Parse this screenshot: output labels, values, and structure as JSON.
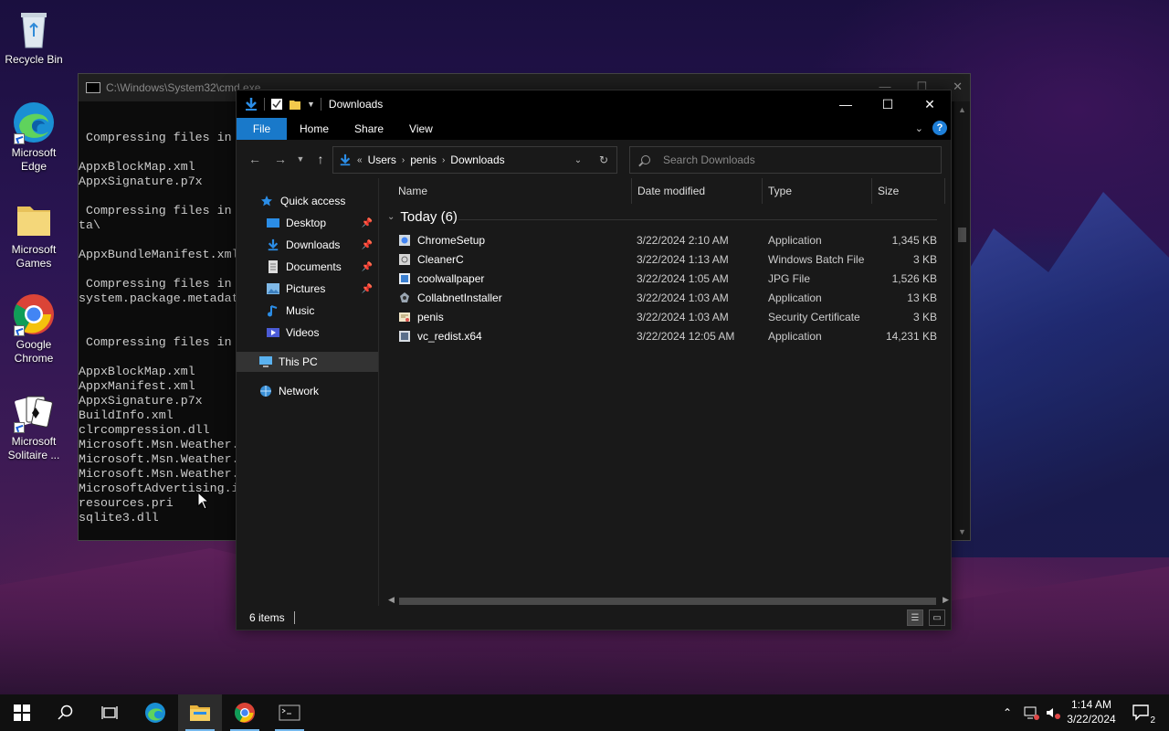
{
  "desktop": {
    "icons": [
      {
        "label": "Recycle Bin"
      },
      {
        "label": "Microsoft Edge"
      },
      {
        "label": "Microsoft Games"
      },
      {
        "label": "Google Chrome"
      },
      {
        "label": "Microsoft Solitaire ..."
      }
    ]
  },
  "cmd": {
    "title": "C:\\Windows\\System32\\cmd.exe",
    "lines": [
      " Compressing files in",
      "AppxBlockMap.xml",
      "AppxSignature.p7x",
      " Compressing files in",
      "ta\\",
      "AppxBundleManifest.xml",
      " Compressing files in",
      "system.package.metadat",
      " Compressing files in",
      "AppxBlockMap.xml",
      "AppxManifest.xml",
      "AppxSignature.p7x",
      "BuildInfo.xml",
      "clrcompression.dll",
      "Microsoft.Msn.Weather.",
      "Microsoft.Msn.Weather.",
      "Microsoft.Msn.Weather.",
      "MicrosoftAdvertising.i",
      "resources.pri",
      "sqlite3.dll"
    ]
  },
  "explorer": {
    "title": "Downloads",
    "ribbon": {
      "tabs": [
        "File",
        "Home",
        "Share",
        "View"
      ],
      "help": "?"
    },
    "address": {
      "overflow": "«",
      "crumbs": [
        "Users",
        "penis",
        "Downloads"
      ]
    },
    "search": {
      "placeholder": "Search Downloads"
    },
    "nav": {
      "quick_access": "Quick access",
      "items": [
        "Desktop",
        "Downloads",
        "Documents",
        "Pictures",
        "Music",
        "Videos"
      ],
      "this_pc": "This PC",
      "network": "Network"
    },
    "columns": [
      "Name",
      "Date modified",
      "Type",
      "Size"
    ],
    "group": "Today (6)",
    "files": [
      {
        "name": "ChromeSetup",
        "date": "3/22/2024 2:10 AM",
        "type": "Application",
        "size": "1,345 KB"
      },
      {
        "name": "CleanerC",
        "date": "3/22/2024 1:13 AM",
        "type": "Windows Batch File",
        "size": "3 KB"
      },
      {
        "name": "coolwallpaper",
        "date": "3/22/2024 1:05 AM",
        "type": "JPG File",
        "size": "1,526 KB"
      },
      {
        "name": "CollabnetInstaller",
        "date": "3/22/2024 1:03 AM",
        "type": "Application",
        "size": "13 KB"
      },
      {
        "name": "penis",
        "date": "3/22/2024 1:03 AM",
        "type": "Security Certificate",
        "size": "3 KB"
      },
      {
        "name": "vc_redist.x64",
        "date": "3/22/2024 12:05 AM",
        "type": "Application",
        "size": "14,231 KB"
      }
    ],
    "status": "6 items"
  },
  "taskbar": {
    "time": "1:14 AM",
    "date": "3/22/2024",
    "notifications": "2"
  },
  "colors": {
    "accent": "#1979ca",
    "taskbar": "#101010",
    "explorer_bg": "#191919"
  }
}
